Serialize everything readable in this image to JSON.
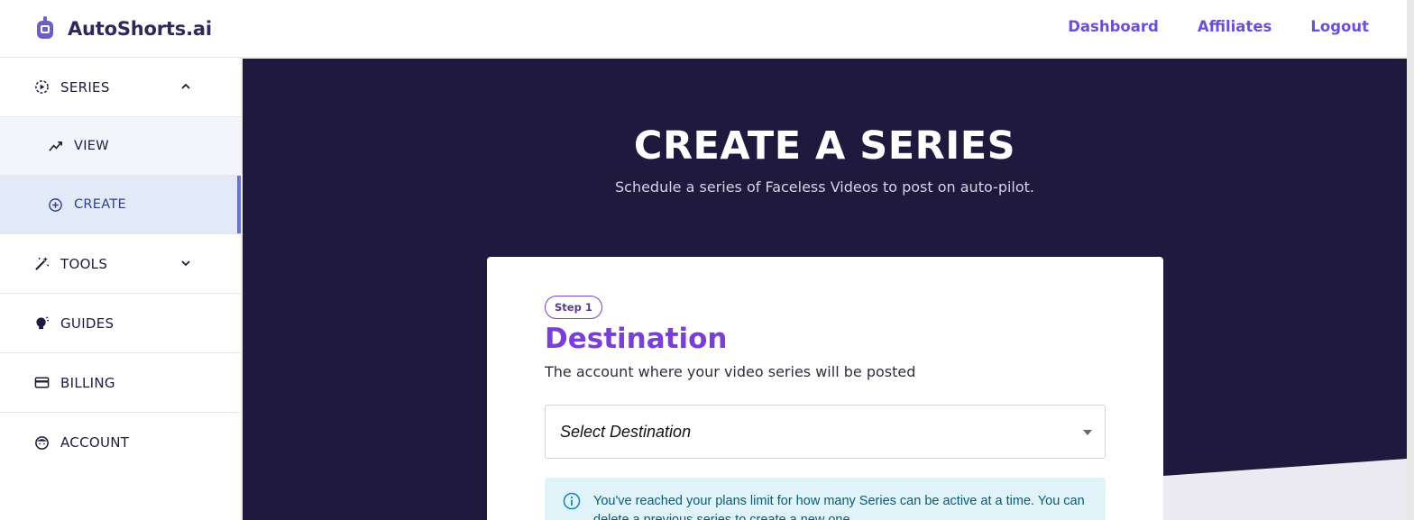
{
  "brand": {
    "name": "AutoShorts.ai"
  },
  "nav": {
    "dashboard": "Dashboard",
    "affiliates": "Affiliates",
    "logout": "Logout"
  },
  "sidebar": {
    "series": "SERIES",
    "view": "VIEW",
    "create": "CREATE",
    "tools": "TOOLS",
    "guides": "GUIDES",
    "billing": "BILLING",
    "account": "ACCOUNT"
  },
  "hero": {
    "title": "CREATE A SERIES",
    "subtitle": "Schedule a series of Faceless Videos to post on auto-pilot."
  },
  "step": {
    "badge": "Step 1",
    "title": "Destination",
    "subtitle": "The account where your video series will be posted",
    "select_value": "Select Destination",
    "alert": "You've reached your plans limit for how many Series can be active at a time. You can delete a previous series to create a new one."
  },
  "colors": {
    "accent": "#6d4fd6",
    "hero_bg": "#1f193d",
    "step_title": "#7a3fd7",
    "alert_bg": "#dff3f8"
  }
}
